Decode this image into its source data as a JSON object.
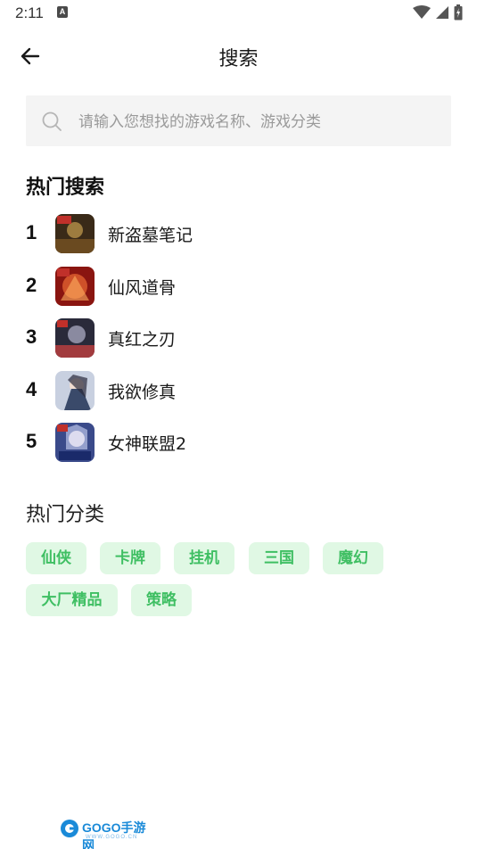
{
  "status_bar": {
    "time": "2:11",
    "notification_letter": "A"
  },
  "header": {
    "title": "搜索"
  },
  "search": {
    "placeholder": "请输入您想找的游戏名称、游戏分类"
  },
  "hot_search": {
    "title": "热门搜索",
    "items": [
      {
        "rank": "1",
        "name": "新盗墓笔记",
        "icon_colors": [
          "#5a3a1a",
          "#c8a050"
        ]
      },
      {
        "rank": "2",
        "name": "仙风道骨",
        "icon_colors": [
          "#8a1010",
          "#e06030"
        ]
      },
      {
        "rank": "3",
        "name": "真红之刃",
        "icon_colors": [
          "#2a2a3a",
          "#c04040"
        ]
      },
      {
        "rank": "4",
        "name": "我欲修真",
        "icon_colors": [
          "#6a7a9a",
          "#d8dde8"
        ]
      },
      {
        "rank": "5",
        "name": "女神联盟2",
        "icon_colors": [
          "#3a4a8a",
          "#c8d0f0"
        ]
      }
    ]
  },
  "hot_categories": {
    "title": "热门分类",
    "tags": [
      "仙侠",
      "卡牌",
      "挂机",
      "三国",
      "魔幻",
      "大厂精品",
      "策略"
    ]
  },
  "watermark": {
    "brand": "GOGO手游网",
    "url": "WWW.GOGO.CN"
  },
  "colors": {
    "tag_bg": "#e0f8e4",
    "tag_text": "#3fbf63",
    "search_bg": "#f4f4f4"
  }
}
